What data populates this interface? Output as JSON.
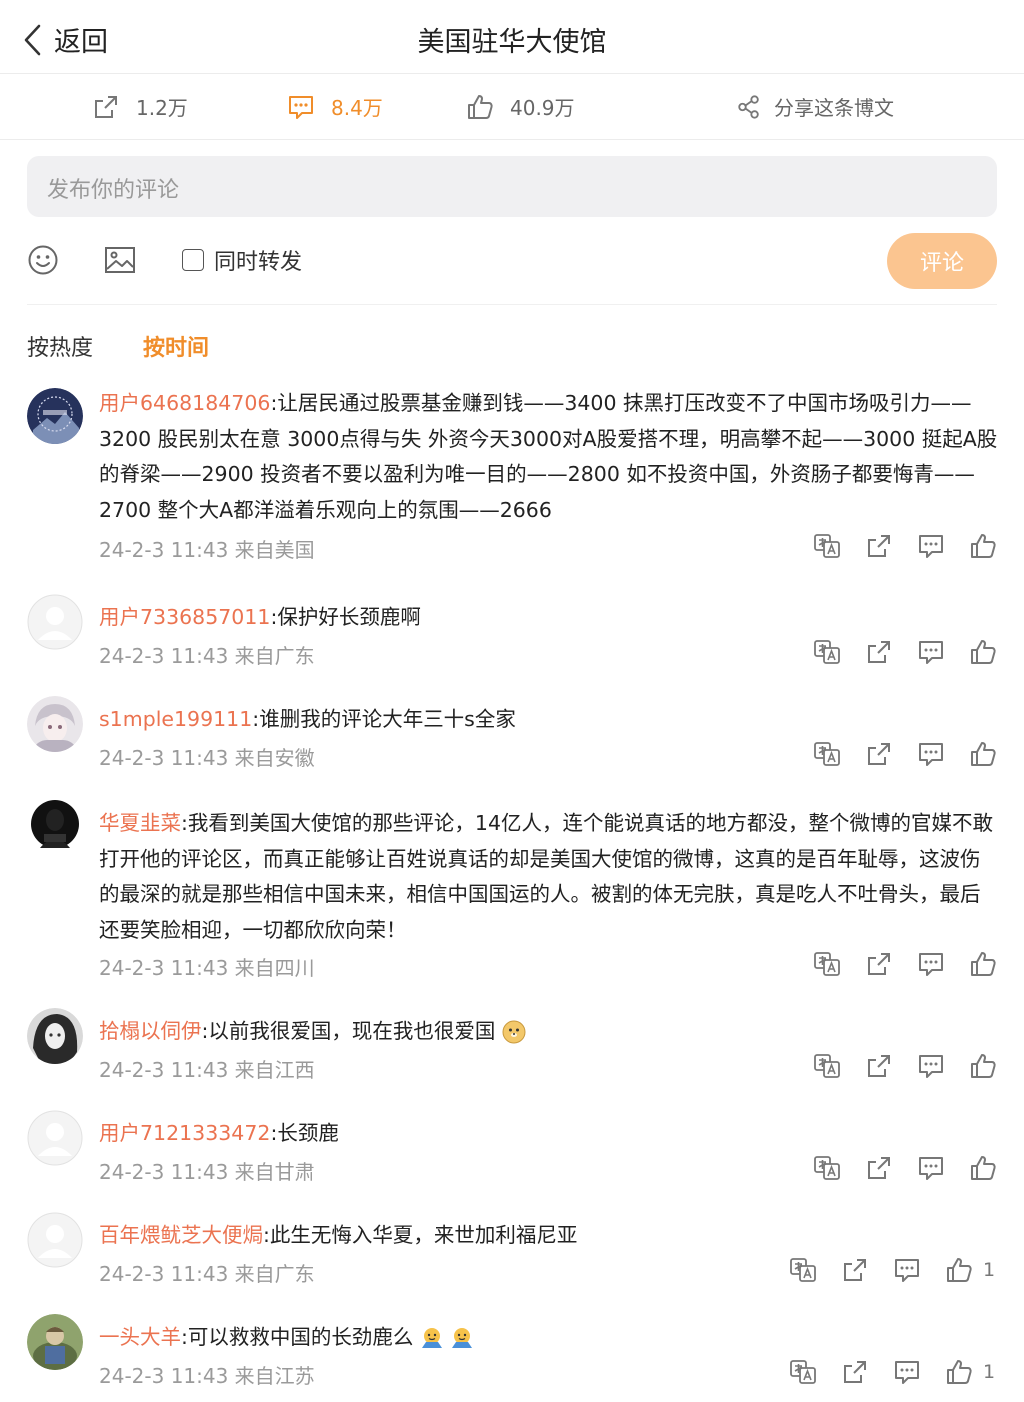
{
  "header": {
    "back_label": "返回",
    "title": "美国驻华大使馆"
  },
  "stats": {
    "reposts": "1.2万",
    "comments": "8.4万",
    "likes": "40.9万",
    "share_label": "分享这条博文"
  },
  "composer": {
    "placeholder": "发布你的评论",
    "repost_label": "同时转发",
    "submit_label": "评论"
  },
  "sort": {
    "hot_label": "按热度",
    "time_label": "按时间"
  },
  "comments": [
    {
      "user": "用户6468184706",
      "text": ":让居民通过股票基金赚到钱——3400 抹黑打压改变不了中国市场吸引力——3200 股民别太在意 3000点得与失 外资今天3000对A股爱搭不理，明高攀不起——3000 挺起A股的脊梁——2900 投资者不要以盈利为唯一目的——2800 如不投资中国，外资肠子都要悔青——2700 整个大A都洋溢着乐观向上的氛围——2666",
      "meta": "24-2-3 11:43 来自美国",
      "likes": ""
    },
    {
      "user": "用户7336857011",
      "text": ":保护好长颈鹿啊",
      "meta": "24-2-3 11:43 来自广东",
      "likes": ""
    },
    {
      "user": "s1mple199111",
      "text": ":谁删我的评论大年三十s全家",
      "meta": "24-2-3 11:43 来自安徽",
      "likes": ""
    },
    {
      "user": "华夏韭菜",
      "text": ":我看到美国大使馆的那些评论，14亿人，连个能说真话的地方都没，整个微博的官媒不敢打开他的评论区，而真正能够让百姓说真话的却是美国大使馆的微博，这真的是百年耻辱，这波伤的最深的就是那些相信中国未来，相信中国国运的人。被割的体无完肤，真是吃人不吐骨头，最后还要笑脸相迎，一切都欣欣向荣！",
      "meta": "24-2-3 11:43 来自四川",
      "likes": ""
    },
    {
      "user": "拾榻以伺伊",
      "text": ":以前我很爱国，现在我也很爱国",
      "meta": "24-2-3 11:43 来自江西",
      "likes": ""
    },
    {
      "user": "用户7121333472",
      "text": ":长颈鹿",
      "meta": "24-2-3 11:43 来自甘肃",
      "likes": ""
    },
    {
      "user": "百年煨鱿芝大便焗",
      "text": ":此生无悔入华夏，来世加利福尼亚",
      "meta": "24-2-3 11:43 来自广东",
      "likes": "1"
    },
    {
      "user": "一头大羊",
      "text": ":可以救救中国的长劲鹿么",
      "meta": "24-2-3 11:43 来自江苏",
      "likes": "1"
    }
  ],
  "colors": {
    "accent": "#f08d2a",
    "username": "#eb7350",
    "submit_bg": "#fbc590"
  }
}
